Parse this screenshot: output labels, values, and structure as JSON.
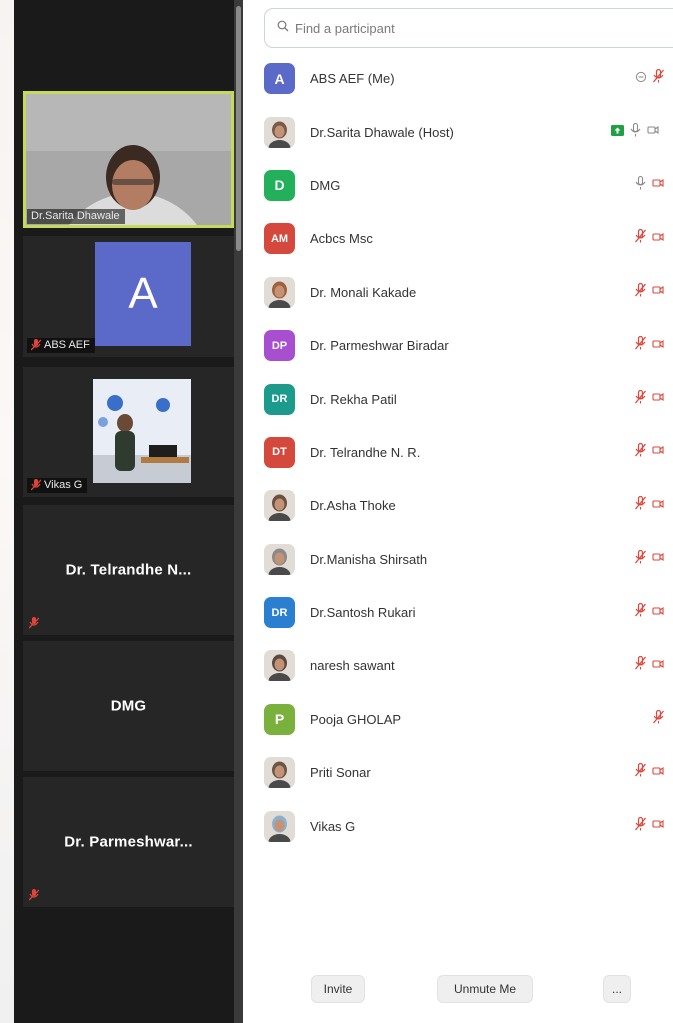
{
  "gallery": {
    "tiles": [
      {
        "name": "Dr.Sarita Dhawale",
        "kind": "video",
        "active": true
      },
      {
        "name": "ABS AEF",
        "kind": "avatar",
        "avatar_letter": "A",
        "muted": true
      },
      {
        "name": "Vikas G",
        "kind": "video",
        "muted": true
      },
      {
        "name": "Dr. Telrandhe N...",
        "kind": "name",
        "muted": true
      },
      {
        "name": "DMG",
        "kind": "name",
        "muted": false
      },
      {
        "name": "Dr. Parmeshwar...",
        "kind": "name",
        "muted": true
      }
    ]
  },
  "panel": {
    "search_placeholder": "Find a participant",
    "participants": [
      {
        "name": "ABS AEF (Me)",
        "avatar": "A",
        "avatar_color": "#5b69c8",
        "photo": false
      },
      {
        "name": "Dr.Sarita Dhawale (Host)",
        "avatar": "",
        "avatar_color": "#7a5a4a",
        "photo": true
      },
      {
        "name": "DMG",
        "avatar": "D",
        "avatar_color": "#22b05a",
        "photo": false
      },
      {
        "name": "Acbcs Msc",
        "avatar": "AM",
        "avatar_color": "#d5483c",
        "photo": false
      },
      {
        "name": "Dr. Monali Kakade",
        "avatar": "",
        "avatar_color": "#a0603a",
        "photo": true
      },
      {
        "name": "Dr. Parmeshwar Biradar",
        "avatar": "DP",
        "avatar_color": "#a84fd0",
        "photo": false
      },
      {
        "name": "Dr. Rekha Patil",
        "avatar": "DR",
        "avatar_color": "#1c9a8c",
        "photo": false
      },
      {
        "name": "Dr. Telrandhe N. R.",
        "avatar": "DT",
        "avatar_color": "#d5483c",
        "photo": false
      },
      {
        "name": "Dr.Asha Thoke",
        "avatar": "",
        "avatar_color": "#6b5040",
        "photo": true
      },
      {
        "name": "Dr.Manisha Shirsath",
        "avatar": "",
        "avatar_color": "#8a8a8a",
        "photo": true
      },
      {
        "name": "Dr.Santosh Rukari",
        "avatar": "DR",
        "avatar_color": "#2a7fd0",
        "photo": false
      },
      {
        "name": "naresh sawant",
        "avatar": "",
        "avatar_color": "#5a4a42",
        "photo": true
      },
      {
        "name": "Pooja GHOLAP",
        "avatar": "P",
        "avatar_color": "#7ab03c",
        "photo": false
      },
      {
        "name": "Priti Sonar",
        "avatar": "",
        "avatar_color": "#6a5648",
        "photo": true
      },
      {
        "name": "Vikas G",
        "avatar": "",
        "avatar_color": "#8ab0d0",
        "photo": true
      }
    ]
  },
  "footer": {
    "invite_label": "Invite",
    "unmute_label": "Unmute Me",
    "more_label": "..."
  },
  "colors": {
    "muted_red": "#e0453a",
    "active_border": "#c5d95a",
    "share_green": "#1fa046"
  }
}
